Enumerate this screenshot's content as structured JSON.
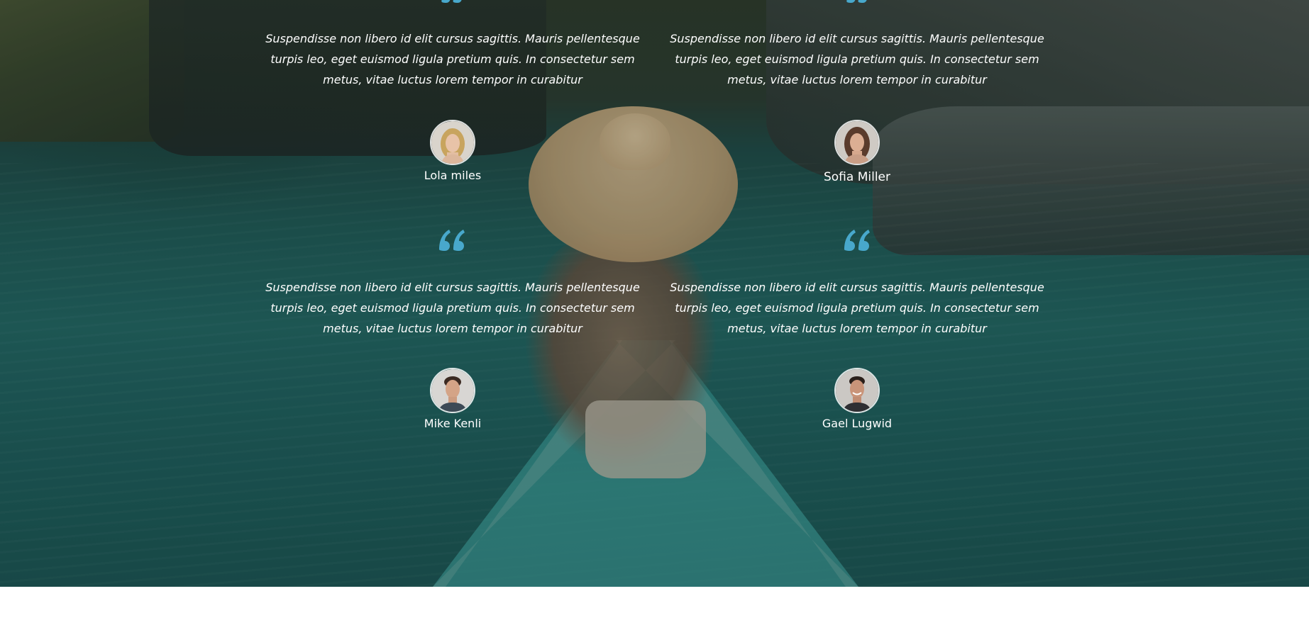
{
  "theme": {
    "quote_color": "#48a8cc",
    "text_color": "#ffffff",
    "page_background": "#ffffff"
  },
  "testimonials": [
    {
      "quote_icon": "quote-icon",
      "text": "Suspendisse non libero id elit cursus sagittis. Mauris pellentesque turpis leo, eget euismod ligula pretium quis. In consectetur sem metus, vitae luctus lorem tempor in curabitur",
      "author": "Lola miles",
      "avatar": "avatar-woman-blonde"
    },
    {
      "quote_icon": "quote-icon",
      "text": "Suspendisse non libero id elit cursus sagittis. Mauris pellentesque turpis leo, eget euismod ligula pretium quis. In consectetur sem metus, vitae luctus lorem tempor in curabitur",
      "author": "Sofia Miller",
      "avatar": "avatar-woman-brunette"
    },
    {
      "quote_icon": "quote-icon",
      "text": "Suspendisse non libero id elit cursus sagittis. Mauris pellentesque turpis leo, eget euismod ligula pretium quis. In consectetur sem metus, vitae luctus lorem tempor in curabitur",
      "author": "Mike Kenli",
      "avatar": "avatar-man-short-hair"
    },
    {
      "quote_icon": "quote-icon",
      "text": "Suspendisse non libero id elit cursus sagittis. Mauris pellentesque turpis leo, eget euismod ligula pretium quis. In consectetur sem metus, vitae luctus lorem tempor in curabitur",
      "author": "Gael Lugwid",
      "avatar": "avatar-man-smiling"
    }
  ]
}
